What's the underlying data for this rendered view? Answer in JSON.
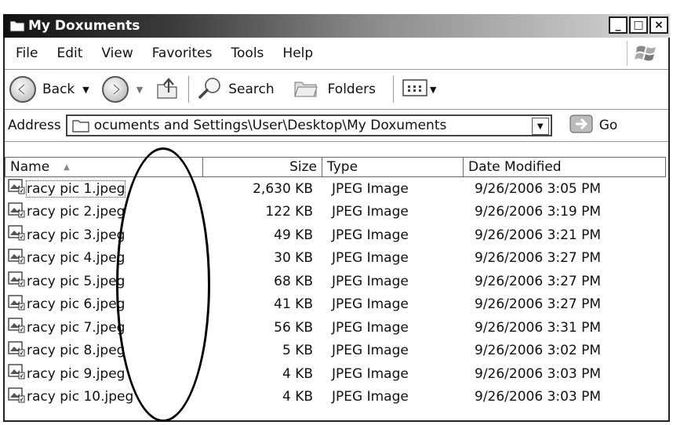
{
  "window": {
    "title": "My Doxuments",
    "controls": {
      "minimize": "_",
      "maximize": "□",
      "close": "×"
    }
  },
  "menu": [
    "File",
    "Edit",
    "View",
    "Favorites",
    "Tools",
    "Help"
  ],
  "toolbar": {
    "back_label": "Back",
    "search_label": "Search",
    "folders_label": "Folders"
  },
  "address": {
    "label": "Address",
    "value": "ocuments and Settings\\User\\Desktop\\My Doxuments",
    "go_label": "Go"
  },
  "columns": {
    "name": "Name",
    "size": "Size",
    "type": "Type",
    "date": "Date Modified"
  },
  "files": [
    {
      "name": "racy pic 1.jpeg",
      "size": "2,630 KB",
      "type": "JPEG Image",
      "date": "9/26/2006 3:05 PM"
    },
    {
      "name": "racy pic 2.jpeg",
      "size": "122 KB",
      "type": "JPEG Image",
      "date": "9/26/2006 3:19 PM"
    },
    {
      "name": "racy pic 3.jpeg",
      "size": "49 KB",
      "type": "JPEG Image",
      "date": "9/26/2006 3:21 PM"
    },
    {
      "name": "racy pic 4.jpeg",
      "size": "30 KB",
      "type": "JPEG Image",
      "date": "9/26/2006 3:27 PM"
    },
    {
      "name": "racy pic 5.jpeg",
      "size": "68 KB",
      "type": "JPEG Image",
      "date": "9/26/2006 3:27 PM"
    },
    {
      "name": "racy pic 6.jpeg",
      "size": "41 KB",
      "type": "JPEG Image",
      "date": "9/26/2006 3:27 PM"
    },
    {
      "name": "racy pic 7.jpeg",
      "size": "56 KB",
      "type": "JPEG Image",
      "date": "9/26/2006 3:31 PM"
    },
    {
      "name": "racy pic 8.jpeg",
      "size": "5 KB",
      "type": "JPEG Image",
      "date": "9/26/2006 3:02 PM"
    },
    {
      "name": "racy pic 9.jpeg",
      "size": "4 KB",
      "type": "JPEG Image",
      "date": "9/26/2006 3:03 PM"
    },
    {
      "name": "racy pic 10.jpeg",
      "size": "4 KB",
      "type": "JPEG Image",
      "date": "9/26/2006 3:03 PM"
    }
  ],
  "icons": {
    "folder": "folder-icon",
    "back": "back-arrow-icon",
    "forward": "forward-arrow-icon",
    "up": "up-folder-icon",
    "search": "search-icon",
    "folders": "folders-icon",
    "views": "views-icon",
    "go": "go-arrow-icon",
    "file": "image-file-icon",
    "windows_flag": "windows-flag-icon"
  }
}
